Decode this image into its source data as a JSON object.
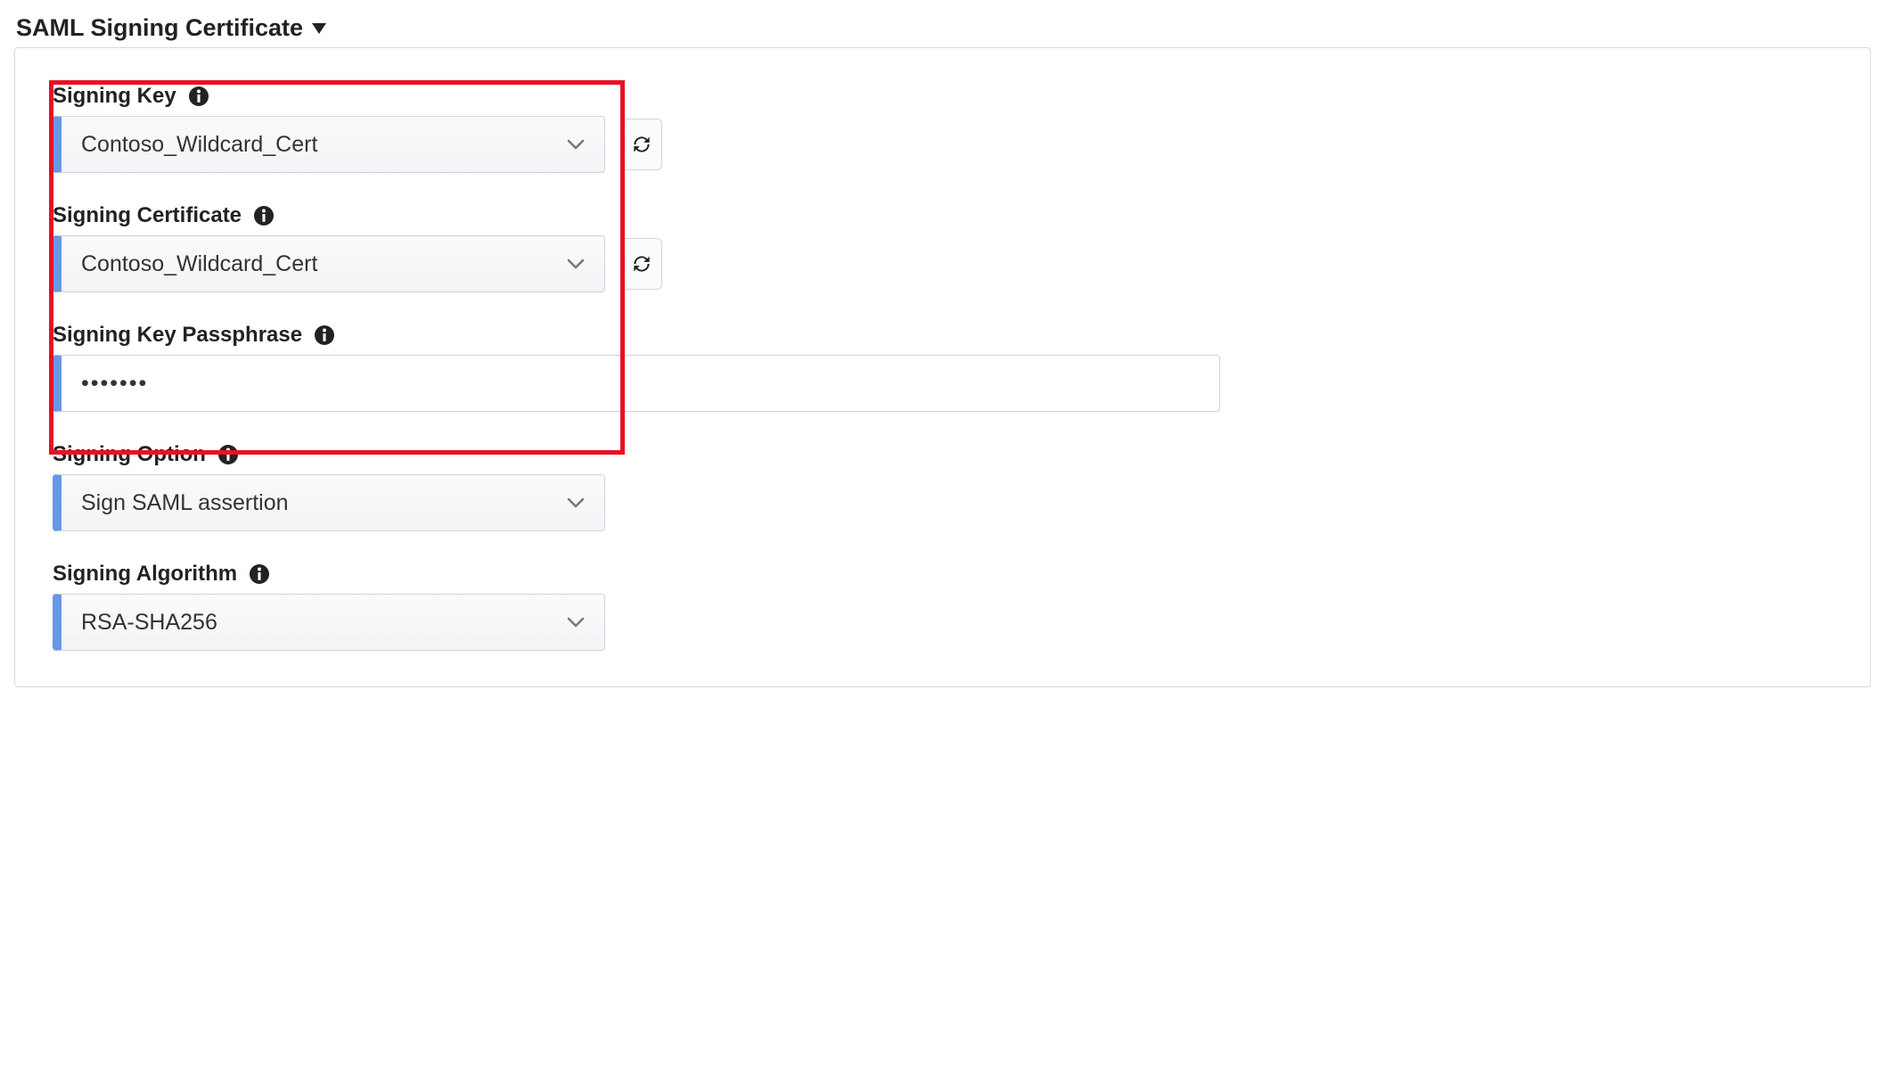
{
  "section": {
    "title": "SAML Signing Certificate"
  },
  "fields": {
    "signingKey": {
      "label": "Signing Key",
      "value": "Contoso_Wildcard_Cert"
    },
    "signingCertificate": {
      "label": "Signing Certificate",
      "value": "Contoso_Wildcard_Cert"
    },
    "signingKeyPassphrase": {
      "label": "Signing Key Passphrase",
      "value": "•••••••"
    },
    "signingOption": {
      "label": "Signing Option",
      "value": "Sign SAML assertion"
    },
    "signingAlgorithm": {
      "label": "Signing Algorithm",
      "value": "RSA-SHA256"
    }
  }
}
